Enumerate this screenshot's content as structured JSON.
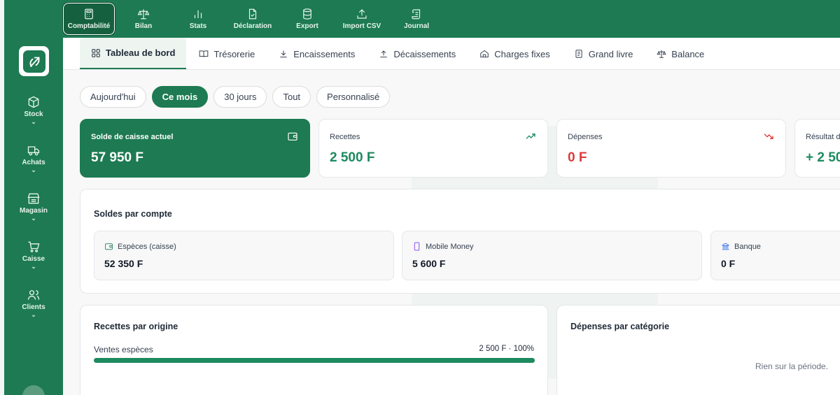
{
  "topnav": [
    {
      "label": "Comptabilité",
      "icon": "calculator-icon",
      "active": true
    },
    {
      "label": "Bilan",
      "icon": "scale-icon"
    },
    {
      "label": "Stats",
      "icon": "bar-chart-icon"
    },
    {
      "label": "Déclaration",
      "icon": "file-check-icon"
    },
    {
      "label": "Export",
      "icon": "database-icon"
    },
    {
      "label": "Import CSV",
      "icon": "upload-icon"
    },
    {
      "label": "Journal",
      "icon": "scroll-icon"
    }
  ],
  "sidebar": [
    {
      "label": "Stock",
      "icon": "box-icon"
    },
    {
      "label": "Achats",
      "icon": "truck-icon"
    },
    {
      "label": "Magasin",
      "icon": "store-icon"
    },
    {
      "label": "Caisse",
      "icon": "cart-icon"
    },
    {
      "label": "Clients",
      "icon": "users-icon"
    }
  ],
  "tabs": [
    {
      "label": "Tableau de bord",
      "icon": "dashboard-icon",
      "active": true
    },
    {
      "label": "Trésorerie",
      "icon": "book-icon"
    },
    {
      "label": "Encaissements",
      "icon": "download-icon"
    },
    {
      "label": "Décaissements",
      "icon": "upload-icon"
    },
    {
      "label": "Charges fixes",
      "icon": "home-icon"
    },
    {
      "label": "Grand livre",
      "icon": "ledger-icon"
    },
    {
      "label": "Balance",
      "icon": "scale-icon"
    }
  ],
  "periods": [
    "Aujourd'hui",
    "Ce mois",
    "30 jours",
    "Tout",
    "Personnalisé"
  ],
  "active_period": "Ce mois",
  "kpis": {
    "cash": {
      "label": "Solde de caisse actuel",
      "value": "57 950 F"
    },
    "income": {
      "label": "Recettes",
      "value": "2 500 F"
    },
    "expenses": {
      "label": "Dépenses",
      "value": "0 F"
    },
    "result": {
      "label": "Résultat d",
      "value": "+ 2 50"
    }
  },
  "accounts": {
    "title": "Soldes par compte",
    "items": [
      {
        "label": "Espèces (caisse)",
        "value": "52 350 F"
      },
      {
        "label": "Mobile Money",
        "value": "5 600 F"
      },
      {
        "label": "Banque",
        "value": "0 F"
      }
    ]
  },
  "income_origin": {
    "title": "Recettes par origine",
    "rows": [
      {
        "label": "Ventes espèces",
        "amount": "2 500 F · 100%",
        "fraction": 1.0
      }
    ]
  },
  "expense_category": {
    "title": "Dépenses par catégorie",
    "empty": "Rien sur la période."
  },
  "colors": {
    "primary": "#1d7a52",
    "income": "#1d8a5f",
    "expense": "#dc3b3b"
  }
}
